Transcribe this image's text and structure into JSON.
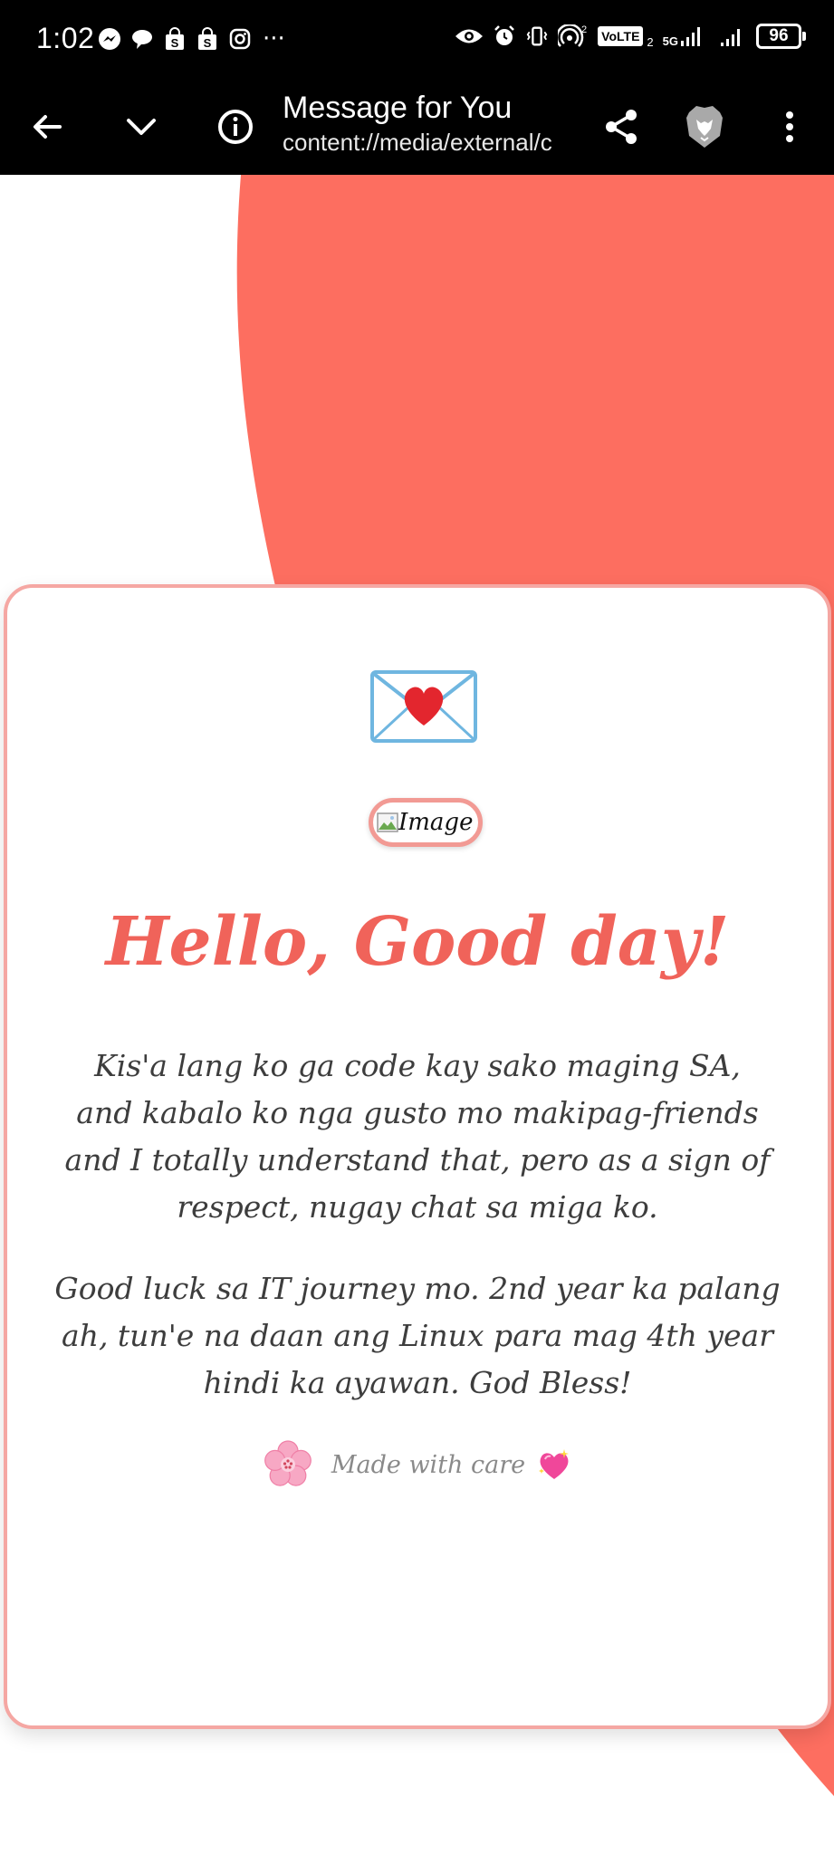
{
  "status_bar": {
    "time": "1:02",
    "more": "···",
    "network_5g": "5G",
    "sim": "2",
    "volte": "VoLTE",
    "battery": "96"
  },
  "toolbar": {
    "title": "Message for You",
    "url": "content://media/external/c"
  },
  "card": {
    "image_alt": "Image",
    "heading": "Hello, Good day!",
    "paragraph1": "Kis'a lang ko ga code kay sako maging SA, and kabalo ko nga gusto mo makipag-friends and I totally understand that, pero as a sign of respect, nugay chat sa miga ko.",
    "paragraph2": "Good luck sa IT journey mo. 2nd year ka palang ah, tun'e na daan ang Linux para mag 4th year hindi ka ayawan. God Bless!",
    "footer_text": "Made with care"
  },
  "colors": {
    "accent": "#f0635a",
    "blob": "#fd6e60",
    "card_border": "#f5a7a3"
  }
}
